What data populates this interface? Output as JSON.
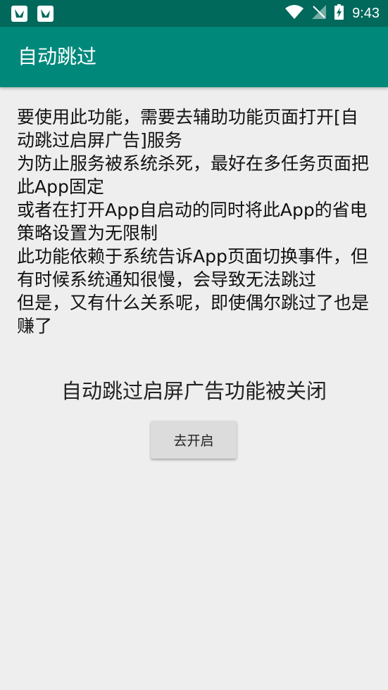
{
  "status_bar": {
    "time": "9:43",
    "icons": [
      "app-notification-icon",
      "app-notification-icon",
      "wifi-icon",
      "no-signal-icon",
      "battery-charging-icon"
    ]
  },
  "app_bar": {
    "title": "自动跳过"
  },
  "info": {
    "lines": [
      "要使用此功能，需要去辅助功能页面打开[自动跳过启屏广告]服务",
      "为防止服务被系统杀死，最好在多任务页面把此App固定",
      "或者在打开App自启动的同时将此App的省电策略设置为无限制",
      "此功能依赖于系统告诉App页面切换事件，但有时候系统通知很慢，会导致无法跳过",
      "但是，又有什么关系呢，即使偶尔跳过了也是赚了"
    ]
  },
  "status_message": "自动跳过启屏广告功能被关闭",
  "enable_button": {
    "label": "去开启"
  }
}
